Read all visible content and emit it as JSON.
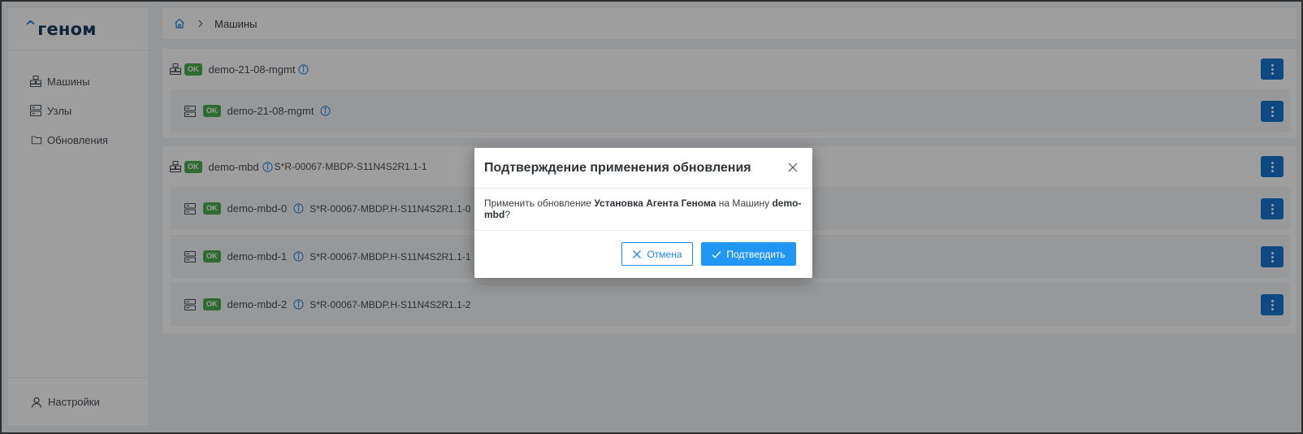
{
  "app": {
    "logo_caret": "^",
    "logo_text": "геном"
  },
  "sidebar": {
    "items": [
      {
        "label": "Машины",
        "icon": "machines-icon"
      },
      {
        "label": "Узлы",
        "icon": "server-icon"
      },
      {
        "label": "Обновления",
        "icon": "folder-icon"
      }
    ],
    "settings_label": "Настройки"
  },
  "breadcrumb": {
    "separator": ">",
    "current": "Машины"
  },
  "machines": [
    {
      "status": "OK",
      "name": "demo-21-08-mgmt",
      "serial": "",
      "nodes": [
        {
          "status": "OK",
          "name": "demo-21-08-mgmt",
          "serial": ""
        }
      ]
    },
    {
      "status": "OK",
      "name": "demo-mbd",
      "serial": "S*R-00067-MBDP-S11N4S2R1.1-1",
      "nodes": [
        {
          "status": "OK",
          "name": "demo-mbd-0",
          "serial": "S*R-00067-MBDP.H-S11N4S2R1.1-0"
        },
        {
          "status": "OK",
          "name": "demo-mbd-1",
          "serial": "S*R-00067-MBDP.H-S11N4S2R1.1-1"
        },
        {
          "status": "OK",
          "name": "demo-mbd-2",
          "serial": "S*R-00067-MBDP.H-S11N4S2R1.1-2"
        }
      ]
    }
  ],
  "modal": {
    "title": "Подтверждение применения обновления",
    "body_prefix": "Применить обновление ",
    "update_name": "Установка Агента Генома",
    "body_middle": " на Машину ",
    "machine_name": "demo-mbd",
    "body_suffix": "?",
    "cancel_label": "Отмена",
    "confirm_label": "Подтвердить"
  },
  "colors": {
    "accent": "#2196f3",
    "kebab": "#1976d2",
    "status_ok": "#4caf50",
    "logo": "#1a3a5c"
  }
}
